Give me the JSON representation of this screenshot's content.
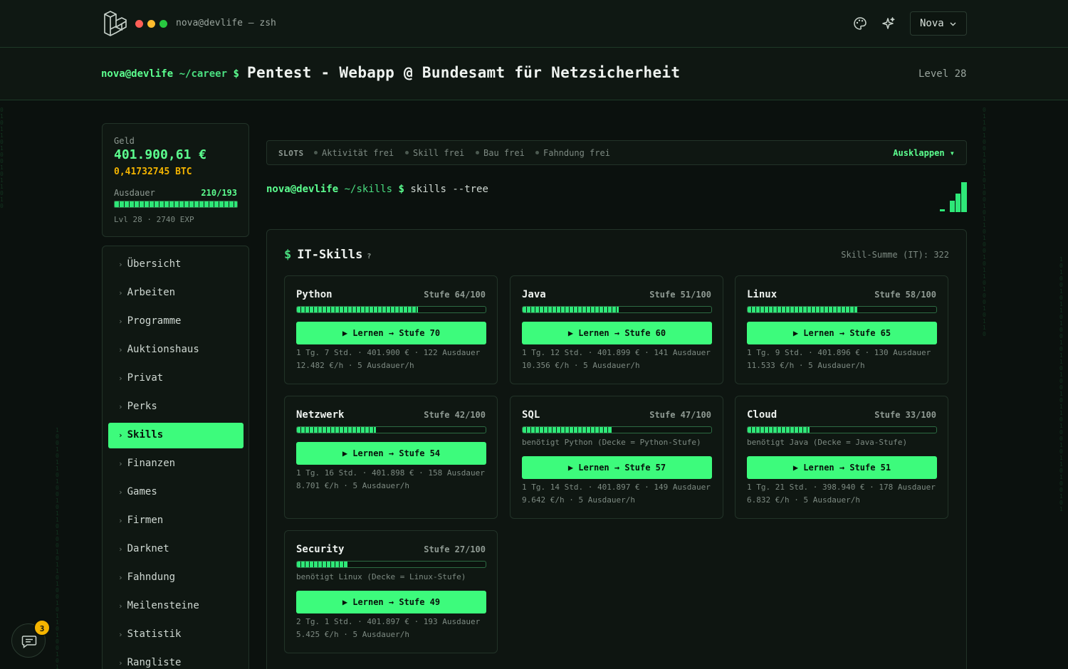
{
  "topbar": {
    "terminal_title": "nova@devlife — zsh",
    "user_label": "Nova"
  },
  "header": {
    "prompt_user": "nova@devlife",
    "prompt_path": "~/career",
    "prompt_symbol": "$",
    "job_title": "Pentest - Webapp @ Bundesamt für Netzsicherheit",
    "level": "Level 28"
  },
  "stats": {
    "money_label": "Geld",
    "money": "401.900,61 €",
    "btc": "0,41732745 BTC",
    "stamina_label": "Ausdauer",
    "stamina_value": "210/193",
    "stamina_fill": 1.0,
    "level_line": "Lvl 28 · 2740 EXP"
  },
  "nav": {
    "items": [
      {
        "label": "Übersicht"
      },
      {
        "label": "Arbeiten"
      },
      {
        "label": "Programme"
      },
      {
        "label": "Auktionshaus"
      },
      {
        "label": "Privat"
      },
      {
        "label": "Perks"
      },
      {
        "label": "Skills",
        "active": true
      },
      {
        "label": "Finanzen"
      },
      {
        "label": "Games"
      },
      {
        "label": "Firmen"
      },
      {
        "label": "Darknet"
      },
      {
        "label": "Fahndung"
      },
      {
        "label": "Meilensteine"
      },
      {
        "label": "Statistik"
      },
      {
        "label": "Rangliste"
      }
    ]
  },
  "chat": {
    "badge": "3"
  },
  "slots": {
    "label": "SLOTS",
    "items": [
      "Aktivität frei",
      "Skill frei",
      "Bau frei",
      "Fahndung frei"
    ],
    "expand": "Ausklappen ▾"
  },
  "command": {
    "user": "nova@devlife",
    "path": "~/skills",
    "symbol": "$",
    "text": "skills --tree"
  },
  "panel": {
    "title": "IT-Skills",
    "help": "?",
    "sum": "Skill-Summe (IT): 322"
  },
  "skills": [
    {
      "name": "Python",
      "stufe": "Stufe 64/100",
      "level": 64,
      "req": "",
      "learn": "▶ Lernen → Stufe 70",
      "info1": "1 Tg. 7 Std. · 401.900 € · 122 Ausdauer",
      "info2": "12.482 €/h · 5 Ausdauer/h"
    },
    {
      "name": "Java",
      "stufe": "Stufe 51/100",
      "level": 51,
      "req": "",
      "learn": "▶ Lernen → Stufe 60",
      "info1": "1 Tg. 12 Std. · 401.899 € · 141 Ausdauer",
      "info2": "10.356 €/h · 5 Ausdauer/h"
    },
    {
      "name": "Linux",
      "stufe": "Stufe 58/100",
      "level": 58,
      "req": "",
      "learn": "▶ Lernen → Stufe 65",
      "info1": "1 Tg. 9 Std. · 401.896 € · 130 Ausdauer",
      "info2": "11.533 €/h · 5 Ausdauer/h"
    },
    {
      "name": "Netzwerk",
      "stufe": "Stufe 42/100",
      "level": 42,
      "req": "",
      "learn": "▶ Lernen → Stufe 54",
      "info1": "1 Tg. 16 Std. · 401.898 € · 158 Ausdauer",
      "info2": "8.701 €/h · 5 Ausdauer/h"
    },
    {
      "name": "SQL",
      "stufe": "Stufe 47/100",
      "level": 47,
      "req": "benötigt Python (Decke = Python-Stufe)",
      "learn": "▶ Lernen → Stufe 57",
      "info1": "1 Tg. 14 Std. · 401.897 € · 149 Ausdauer",
      "info2": "9.642 €/h · 5 Ausdauer/h"
    },
    {
      "name": "Cloud",
      "stufe": "Stufe 33/100",
      "level": 33,
      "req": "benötigt Java (Decke = Java-Stufe)",
      "learn": "▶ Lernen → Stufe 51",
      "info1": "1 Tg. 21 Std. · 398.940 € · 178 Ausdauer",
      "info2": "6.832 €/h · 5 Ausdauer/h"
    },
    {
      "name": "Security",
      "stufe": "Stufe 27/100",
      "level": 27,
      "req": "benötigt Linux (Decke = Linux-Stufe)",
      "learn": "▶ Lernen → Stufe 49",
      "info1": "2 Tg. 1 Std. · 401.897 € · 193 Ausdauer",
      "info2": "5.425 €/h · 5 Ausdauer/h"
    }
  ],
  "colors": {
    "accent": "#3dfb7c",
    "background": "#0b110e",
    "btc": "#f4b400"
  }
}
